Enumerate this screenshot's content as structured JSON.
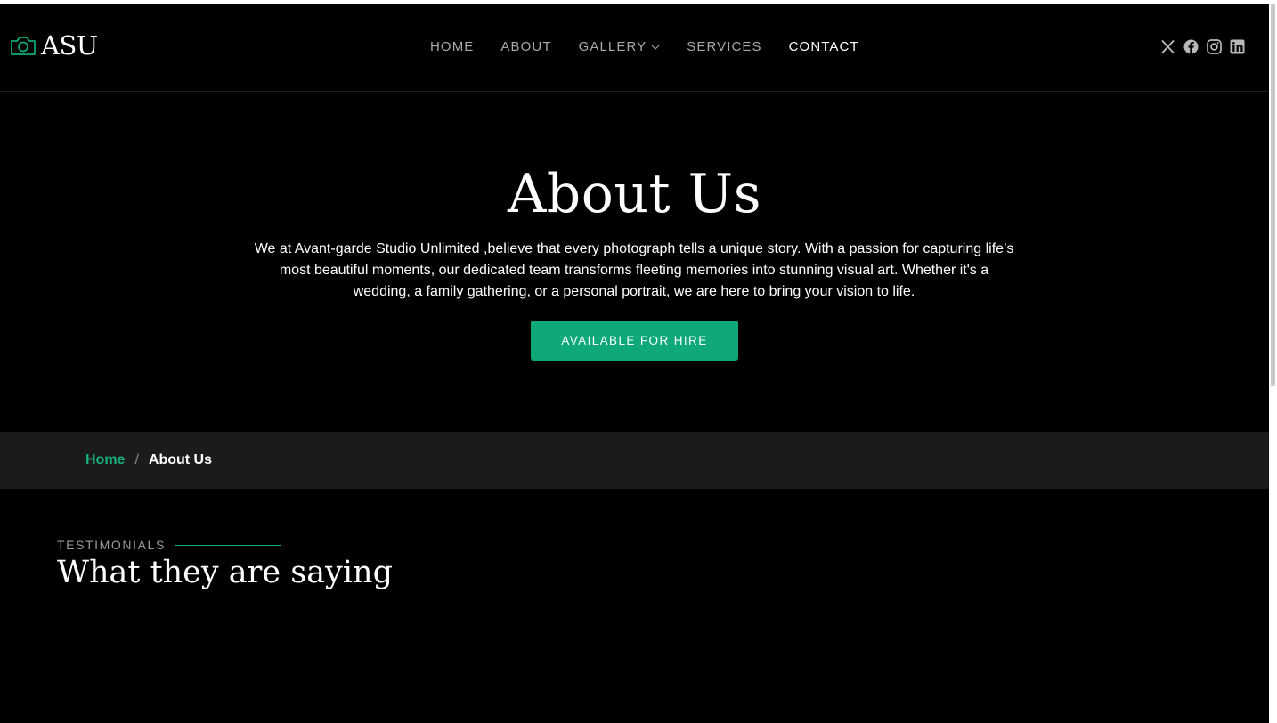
{
  "brand": {
    "name": "ASU",
    "icon": "camera-icon",
    "accent": "#0ea879"
  },
  "nav": {
    "items": [
      {
        "label": "HOME",
        "active": false
      },
      {
        "label": "ABOUT",
        "active": false
      },
      {
        "label": "GALLERY",
        "active": false,
        "has_dropdown": true
      },
      {
        "label": "SERVICES",
        "active": false
      },
      {
        "label": "CONTACT",
        "active": true
      }
    ]
  },
  "social": [
    "x-icon",
    "facebook-icon",
    "instagram-icon",
    "linkedin-icon"
  ],
  "hero": {
    "title": "About Us",
    "text": "We at Avant-garde Studio Unlimited ,believe that every photograph tells a unique story. With a passion for capturing life’s most beautiful moments, our dedicated team transforms fleeting memories into stunning visual art. Whether it's a wedding, a family gathering, or a personal portrait, we are here to bring your vision to life.",
    "button": "AVAILABLE FOR HIRE"
  },
  "breadcrumb": {
    "home": "Home",
    "separator": "/",
    "current": "About Us"
  },
  "testimonials": {
    "label": "TESTIMONIALS",
    "title": "What they are saying"
  }
}
